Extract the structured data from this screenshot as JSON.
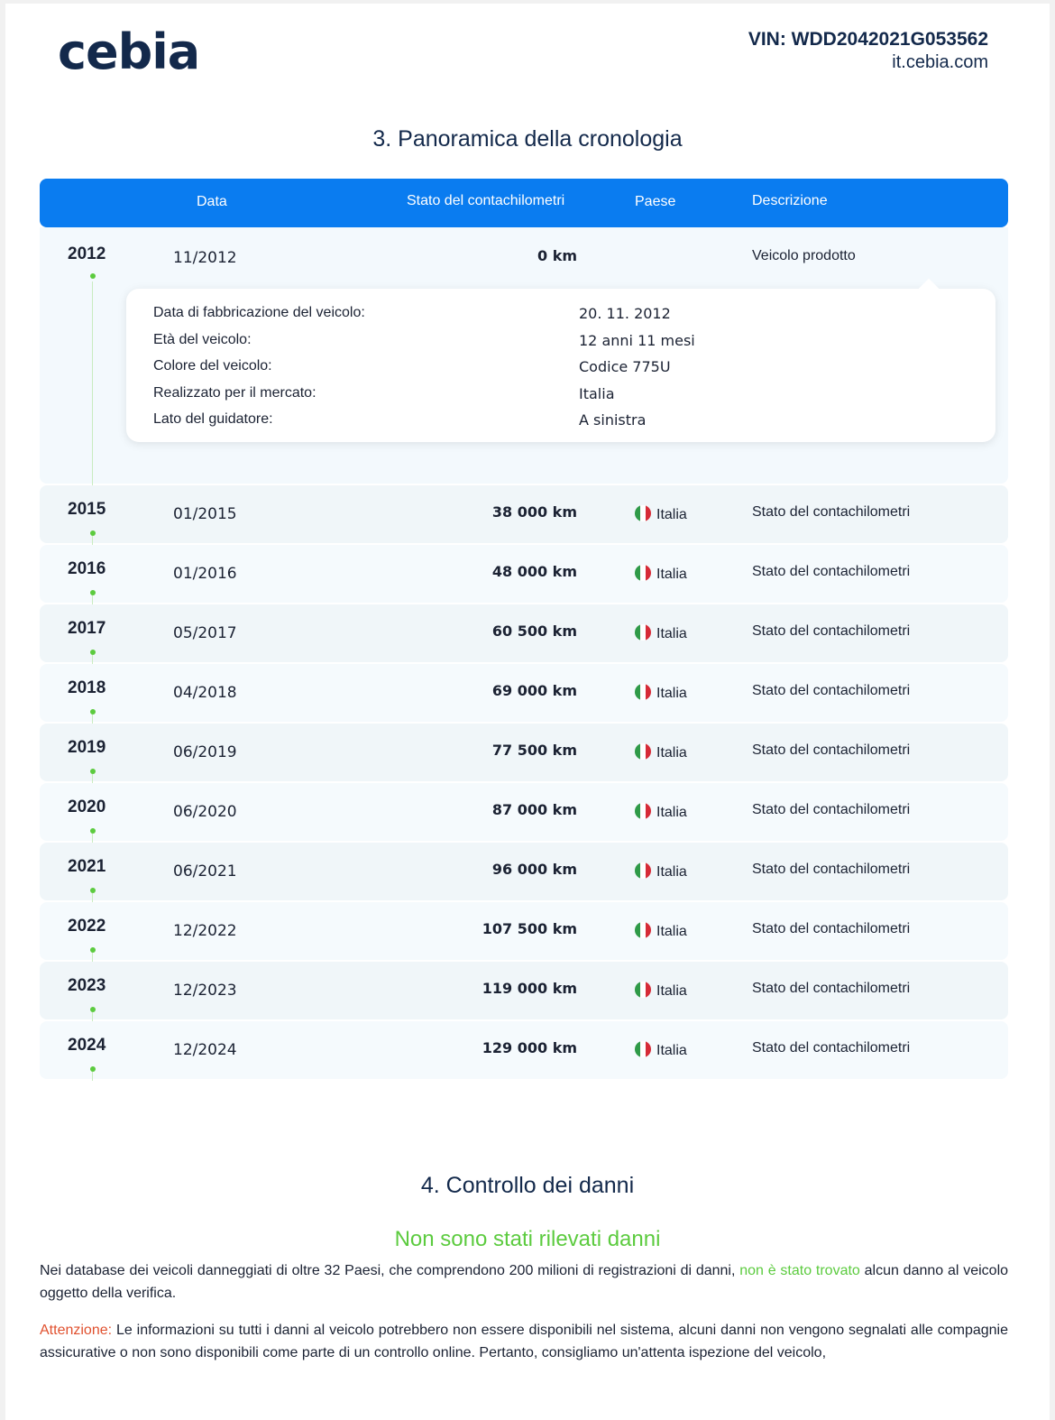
{
  "header": {
    "logo": "cebia",
    "vin": "VIN: WDD2042021G053562",
    "site": "it.cebia.com"
  },
  "section3": {
    "title": "3. Panoramica della cronologia",
    "columns": {
      "data": "Data",
      "odometer": "Stato del contachilometri",
      "country": "Paese",
      "description": "Descrizione"
    },
    "first": {
      "year": "2012",
      "date": "11/2012",
      "km": "0 km",
      "description": "Veicolo prodotto",
      "details": [
        {
          "label": "Data di fabbricazione del veicolo:",
          "value": "20. 11. 2012"
        },
        {
          "label": "Età del veicolo:",
          "value": "12 anni 11 mesi"
        },
        {
          "label": "Colore del veicolo:",
          "value": "Codice 775U"
        },
        {
          "label": "Realizzato per il mercato:",
          "value": "Italia"
        },
        {
          "label": "Lato del guidatore:",
          "value": "A sinistra"
        }
      ]
    },
    "rows": [
      {
        "year": "2015",
        "date": "01/2015",
        "km": "38 000 km",
        "country": "Italia",
        "description": "Stato del contachilometri"
      },
      {
        "year": "2016",
        "date": "01/2016",
        "km": "48 000 km",
        "country": "Italia",
        "description": "Stato del contachilometri"
      },
      {
        "year": "2017",
        "date": "05/2017",
        "km": "60 500 km",
        "country": "Italia",
        "description": "Stato del contachilometri"
      },
      {
        "year": "2018",
        "date": "04/2018",
        "km": "69 000 km",
        "country": "Italia",
        "description": "Stato del contachilometri"
      },
      {
        "year": "2019",
        "date": "06/2019",
        "km": "77 500 km",
        "country": "Italia",
        "description": "Stato del contachilometri"
      },
      {
        "year": "2020",
        "date": "06/2020",
        "km": "87 000 km",
        "country": "Italia",
        "description": "Stato del contachilometri"
      },
      {
        "year": "2021",
        "date": "06/2021",
        "km": "96 000 km",
        "country": "Italia",
        "description": "Stato del contachilometri"
      },
      {
        "year": "2022",
        "date": "12/2022",
        "km": "107 500 km",
        "country": "Italia",
        "description": "Stato del contachilometri"
      },
      {
        "year": "2023",
        "date": "12/2023",
        "km": "119 000 km",
        "country": "Italia",
        "description": "Stato del contachilometri"
      },
      {
        "year": "2024",
        "date": "12/2024",
        "km": "129 000 km",
        "country": "Italia",
        "description": "Stato del contachilometri"
      }
    ]
  },
  "section4": {
    "title": "4. Controllo dei danni",
    "status": "Non sono stati rilevati danni",
    "para1_a": "Nei database dei veicoli danneggiati di oltre 32 Paesi, che comprendono 200 milioni di registrazioni di danni, ",
    "para1_green": "non è stato trovato",
    "para1_b": " alcun danno al veicolo oggetto della verifica.",
    "para2_red": "Attenzione:",
    "para2_b": " Le informazioni su tutti i danni al veicolo potrebbero non essere disponibili nel sistema, alcuni danni non vengono segnalati alle compagnie assicurative o non sono disponibili come parte di un controllo online. Pertanto, consigliamo un'attenta ispezione del veicolo,"
  },
  "colors": {
    "brand_blue": "#0a7cf0",
    "navy": "#13294b",
    "green": "#5ccb3f",
    "red": "#e0502e"
  },
  "icons": {
    "flag": "italy-flag-icon",
    "timeline_dot": "timeline-dot-icon"
  }
}
